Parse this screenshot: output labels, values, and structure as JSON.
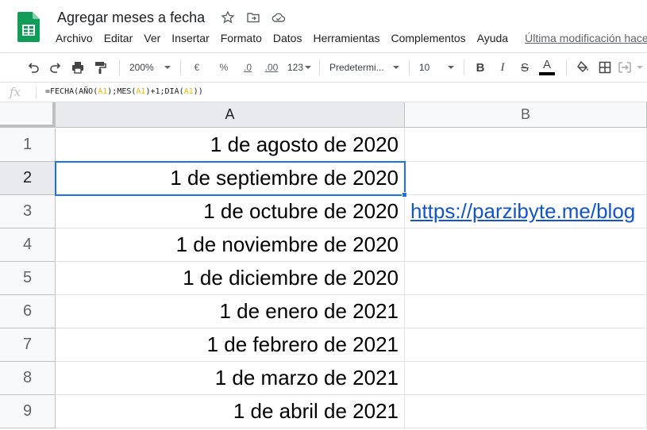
{
  "app": {
    "title": "Agregar meses a fecha",
    "last_edit": "Última modificación hace"
  },
  "menu": [
    "Archivo",
    "Editar",
    "Ver",
    "Insertar",
    "Formato",
    "Datos",
    "Herramientas",
    "Complementos",
    "Ayuda"
  ],
  "toolbar": {
    "zoom": "200%",
    "currency": "€",
    "percent": "%",
    "dec_decrease": ".0",
    "dec_increase": ".00",
    "more_formats": "123",
    "font": "Predetermi...",
    "font_size": "10",
    "bold": "B",
    "italic": "I",
    "strike": "S",
    "text_color": "A"
  },
  "formula_bar": {
    "fx": "fx",
    "parts": [
      "=FECHA(AÑO(",
      "A1",
      ");MES(",
      "A1",
      ")+1;DIA(",
      "A1",
      "))"
    ]
  },
  "columns": [
    "A",
    "B"
  ],
  "rows": [
    {
      "num": "1",
      "a": "1 de agosto de 2020",
      "b": ""
    },
    {
      "num": "2",
      "a": "1 de septiembre de 2020",
      "b": ""
    },
    {
      "num": "3",
      "a": "1 de octubre de 2020",
      "b": "https://parzibyte.me/blog"
    },
    {
      "num": "4",
      "a": "1 de noviembre de 2020",
      "b": ""
    },
    {
      "num": "5",
      "a": "1 de diciembre de 2020",
      "b": ""
    },
    {
      "num": "6",
      "a": "1 de enero de 2021",
      "b": ""
    },
    {
      "num": "7",
      "a": "1 de febrero de 2021",
      "b": ""
    },
    {
      "num": "8",
      "a": "1 de marzo de 2021",
      "b": ""
    },
    {
      "num": "9",
      "a": "1 de abril de 2021",
      "b": ""
    }
  ],
  "icons": {
    "logo": "google-sheets-logo",
    "star": "star-icon",
    "move": "move-to-folder-icon",
    "cloud": "cloud-saved-icon"
  },
  "colors": {
    "accent": "#1a73e8",
    "link": "#1155cc",
    "sheets_green": "#0f9d58"
  }
}
